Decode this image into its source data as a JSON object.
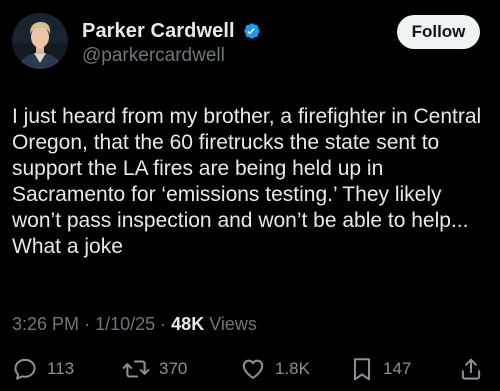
{
  "author": {
    "display_name": "Parker Cardwell",
    "handle": "@parkercardwell",
    "verified": true,
    "verified_color": "#1d9bf0"
  },
  "follow_button": {
    "label": "Follow"
  },
  "tweet": {
    "text": "I just heard from my brother, a firefighter in Central Oregon, that the 60 firetrucks the state sent to support the LA fires are being held up in Sacramento for ‘emissions testing.’ They likely won’t pass inspection and won’t be able to help... What a joke",
    "time": "3:26 PM",
    "date": "1/10/25",
    "separator": "·",
    "views_count": "48K",
    "views_label": "Views"
  },
  "actions": {
    "reply": {
      "icon": "reply-icon",
      "count": "113"
    },
    "retweet": {
      "icon": "retweet-icon",
      "count": "370"
    },
    "like": {
      "icon": "heart-icon",
      "count": "1.8K"
    },
    "bookmark": {
      "icon": "bookmark-icon",
      "count": "147"
    },
    "share": {
      "icon": "share-icon"
    }
  },
  "colors": {
    "background": "#000000",
    "text_primary": "#e7e9ea",
    "text_secondary": "#71767b",
    "follow_bg": "#eff3f4"
  }
}
